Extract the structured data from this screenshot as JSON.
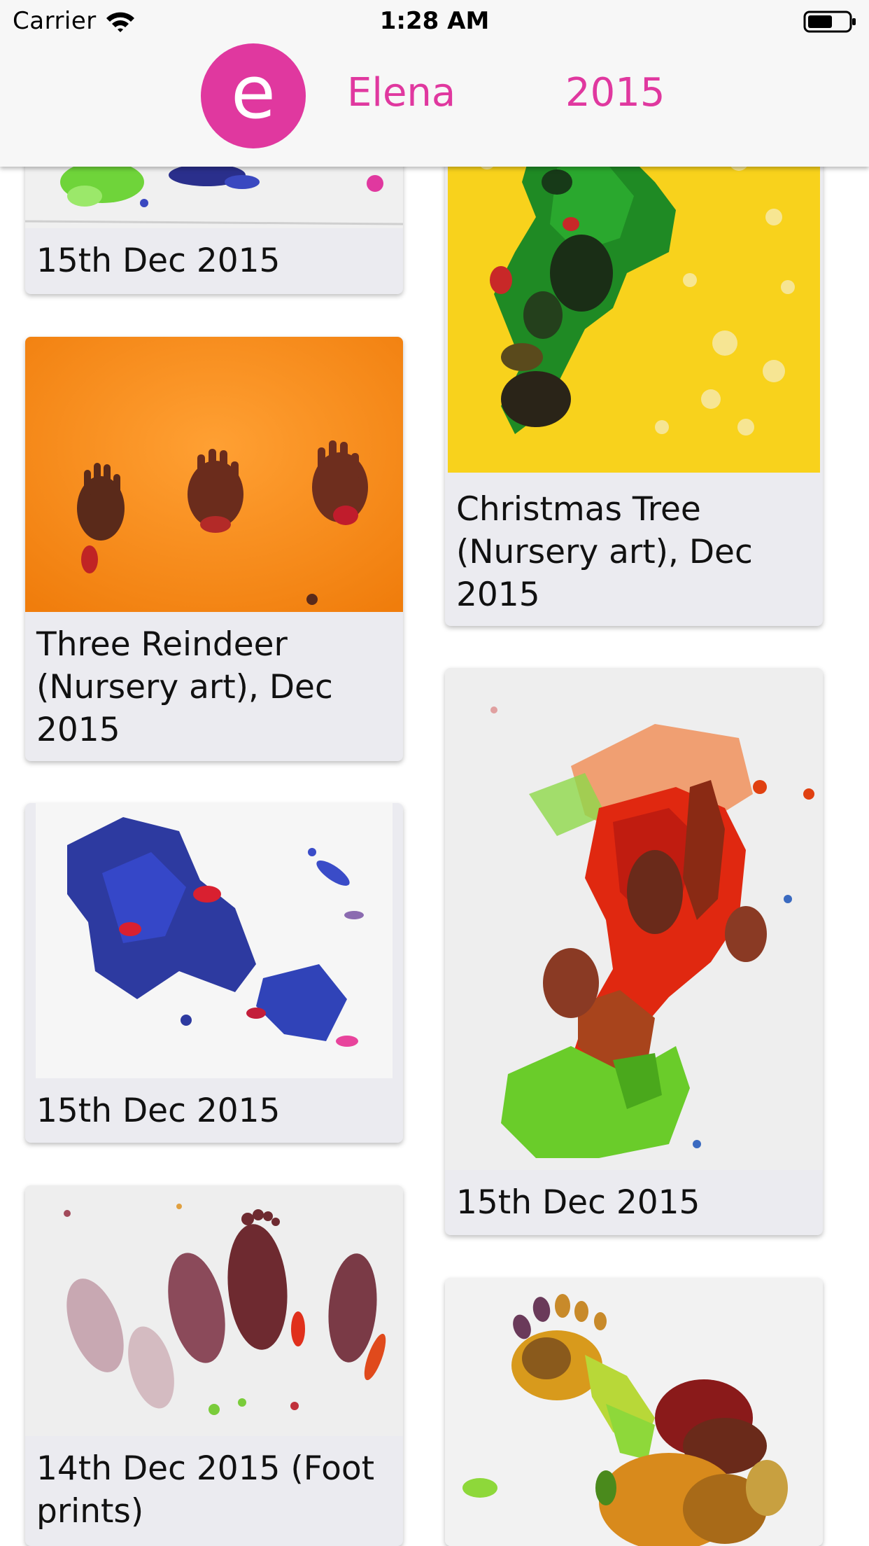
{
  "status_bar": {
    "carrier": "Carrier",
    "time": "1:28 AM",
    "icons": [
      "wifi-icon",
      "battery-icon"
    ]
  },
  "header": {
    "avatar_letter": "e",
    "name": "Elena",
    "year": "2015",
    "accent_color": "#e0389f"
  },
  "gallery": {
    "left_column": [
      {
        "caption": "15th Dec 2015",
        "artwork": "paint splatter on white"
      },
      {
        "caption": "Three Reindeer (Nursery art), Dec 2015",
        "artwork": "three brown handprints on orange"
      },
      {
        "caption": "15th Dec 2015",
        "artwork": "blue and red paint on white"
      },
      {
        "caption": "14th Dec 2015 (Foot prints)",
        "artwork": "purple footprints on white"
      }
    ],
    "right_column": [
      {
        "caption": "Christmas Tree (Nursery art), Dec 2015",
        "artwork": "green tree painting on yellow"
      },
      {
        "caption": "15th Dec 2015",
        "artwork": "red, orange and green paint on white"
      },
      {
        "caption": "",
        "artwork": "footprint in yellow, green and red on white"
      }
    ]
  },
  "colors": {
    "card_background": "#ebebf0",
    "header_background": "#f7f7f7"
  }
}
